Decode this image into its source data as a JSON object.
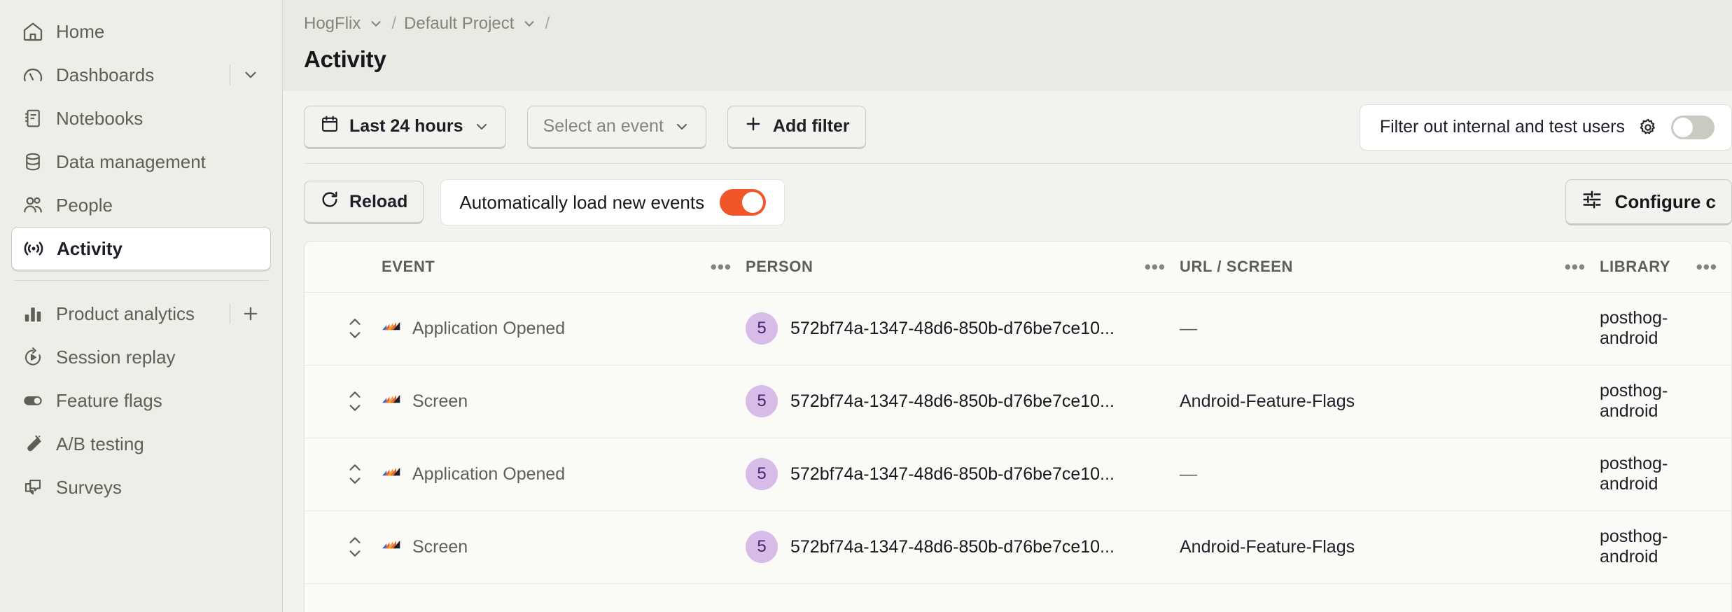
{
  "sidebar": {
    "primary": [
      {
        "label": "Home",
        "icon": "home-icon",
        "trailing": "none"
      },
      {
        "label": "Dashboards",
        "icon": "gauge-icon",
        "trailing": "chevron"
      },
      {
        "label": "Notebooks",
        "icon": "notebook-icon",
        "trailing": "none"
      },
      {
        "label": "Data management",
        "icon": "database-icon",
        "trailing": "none"
      },
      {
        "label": "People",
        "icon": "people-icon",
        "trailing": "none"
      },
      {
        "label": "Activity",
        "icon": "broadcast-icon",
        "trailing": "none",
        "active": true
      }
    ],
    "secondary": [
      {
        "label": "Product analytics",
        "icon": "bar-chart-icon",
        "trailing": "plus"
      },
      {
        "label": "Session replay",
        "icon": "replay-icon",
        "trailing": "none"
      },
      {
        "label": "Feature flags",
        "icon": "toggle-icon",
        "trailing": "none"
      },
      {
        "label": "A/B testing",
        "icon": "flask-icon",
        "trailing": "none"
      },
      {
        "label": "Surveys",
        "icon": "survey-icon",
        "trailing": "none"
      }
    ]
  },
  "breadcrumb": {
    "org": "HogFlix",
    "project": "Default Project",
    "separator": "/"
  },
  "page": {
    "title": "Activity"
  },
  "filters": {
    "date_range": "Last 24 hours",
    "event_select": "Select an event",
    "add_filter": "Add filter",
    "internal_users_label": "Filter out internal and test users",
    "internal_users_enabled": false
  },
  "actions": {
    "reload": "Reload",
    "autoload_label": "Automatically load new events",
    "autoload_enabled": true,
    "configure": "Configure c"
  },
  "table": {
    "columns": [
      {
        "key": "handle",
        "label": ""
      },
      {
        "key": "event",
        "label": "EVENT"
      },
      {
        "key": "person",
        "label": "PERSON"
      },
      {
        "key": "url",
        "label": "URL / SCREEN"
      },
      {
        "key": "library",
        "label": "LIBRARY"
      }
    ],
    "column_menu_glyph": "•••",
    "rows": [
      {
        "event": "Application Opened",
        "event_icon": "posthog-stripes-icon",
        "person_badge": "5",
        "person_id": "572bf74a-1347-48d6-850b-d76be7ce10...",
        "url": "—",
        "library": "posthog-android"
      },
      {
        "event": "Screen",
        "event_icon": "posthog-stripes-icon",
        "person_badge": "5",
        "person_id": "572bf74a-1347-48d6-850b-d76be7ce10...",
        "url": "Android-Feature-Flags",
        "library": "posthog-android"
      },
      {
        "event": "Application Opened",
        "event_icon": "posthog-stripes-icon",
        "person_badge": "5",
        "person_id": "572bf74a-1347-48d6-850b-d76be7ce10...",
        "url": "—",
        "library": "posthog-android"
      },
      {
        "event": "Screen",
        "event_icon": "posthog-stripes-icon",
        "person_badge": "5",
        "person_id": "572bf74a-1347-48d6-850b-d76be7ce10...",
        "url": "Android-Feature-Flags",
        "library": "posthog-android"
      }
    ]
  },
  "colors": {
    "accent_orange": "#F1562A",
    "sidebar_bg": "#EDEEE8",
    "topbar_bg": "#E9EAE3",
    "content_bg": "#F2F2EE",
    "table_bg": "#FAFAF7",
    "person_badge_bg": "#D7BCE8",
    "person_badge_fg": "#44256B"
  }
}
